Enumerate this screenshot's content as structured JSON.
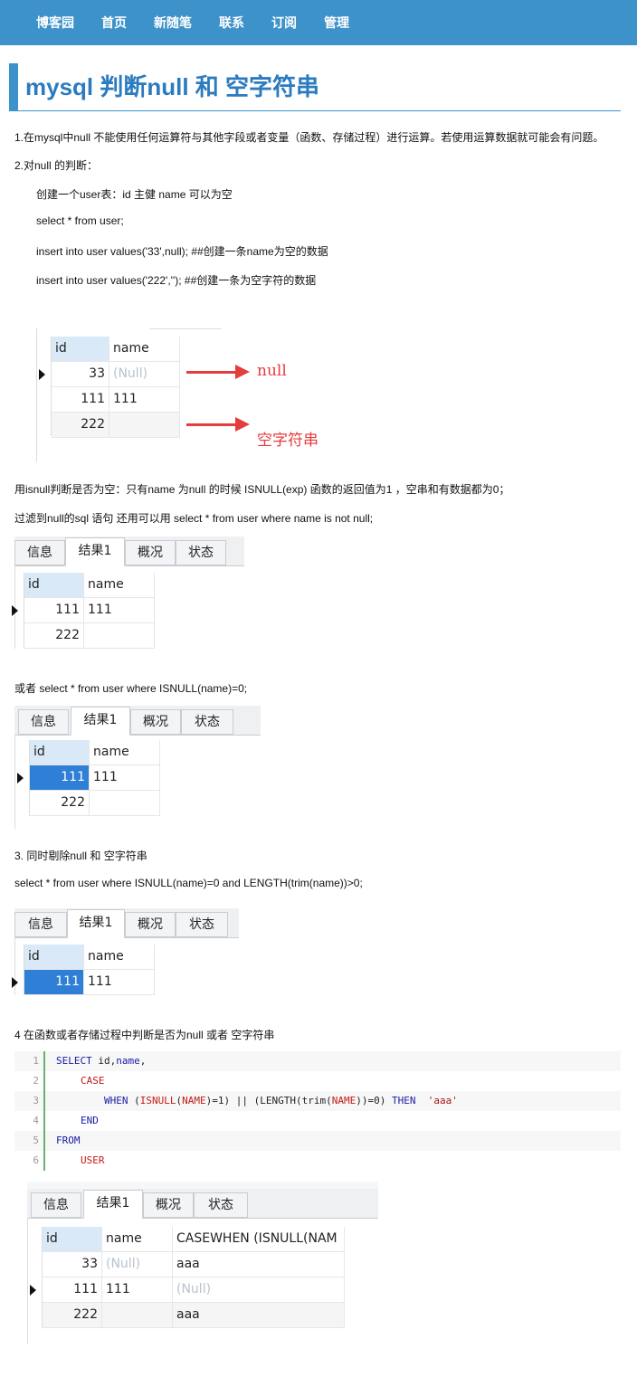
{
  "nav": {
    "items": [
      "博客园",
      "首页",
      "新随笔",
      "联系",
      "订阅",
      "管理"
    ]
  },
  "post": {
    "title": "mysql 判断null 和 空字符串",
    "p1": "1.在mysql中null 不能使用任何运算符与其他字段或者变量（函数、存储过程）进行运算。若使用运算数据就可能会有问题。",
    "p2": "2.对null 的判断：",
    "p3": "创建一个user表：id 主健 name 可以为空",
    "p4": "select * from user;",
    "p5": "insert into user values('33',null);  ##创建一条name为空的数据",
    "p6": "insert into user values('222','');  ##创建一条为空字符的数据",
    "p7": "用isnull判断是否为空：只有name 为null 的时候 ISNULL(exp) 函数的返回值为1 ，空串和有数据都为0；",
    "p8": " 过滤到null的sql 语句 还用可以用  select * from user where name is not null;",
    "p9": "或者  select * from user where ISNULL(name)=0;",
    "p10": "3. 同时剔除null 和 空字符串",
    "p11": "select * from user where ISNULL(name)=0 and LENGTH(trim(name))>0;",
    "p12": "4 在函数或者存储过程中判断是否为null 或者 空字符串"
  },
  "tabs": [
    "信息",
    "结果1",
    "概况",
    "状态"
  ],
  "grid1": {
    "headers": [
      "id",
      "name"
    ],
    "rows": [
      [
        "33",
        "(Null)"
      ],
      [
        "111",
        "111"
      ],
      [
        "222",
        ""
      ]
    ],
    "anno_null": "null",
    "anno_empty": "空字符串"
  },
  "grid2": {
    "headers": [
      "id",
      "name"
    ],
    "rows": [
      [
        "111",
        "111"
      ],
      [
        "222",
        ""
      ]
    ]
  },
  "grid3": {
    "headers": [
      "id",
      "name"
    ],
    "rows": [
      [
        "111",
        "111"
      ],
      [
        "222",
        ""
      ]
    ]
  },
  "grid4": {
    "headers": [
      "id",
      "name"
    ],
    "rows": [
      [
        "111",
        "111"
      ]
    ]
  },
  "grid5": {
    "headers": [
      "id",
      "name",
      "CASEWHEN (ISNULL(NAM"
    ],
    "rows": [
      [
        "33",
        "(Null)",
        "aaa"
      ],
      [
        "111",
        "111",
        "(Null)"
      ],
      [
        "222",
        "",
        "aaa"
      ]
    ]
  },
  "code": {
    "line_numbers": [
      "1",
      "2",
      "3",
      "4",
      "5",
      "6"
    ],
    "l1a": "SELECT",
    "l1b": " id,",
    "l1c": "name",
    "l1d": ",",
    "l2": "CASE",
    "l3a": "WHEN",
    "l3b": " (",
    "l3c": "ISNULL",
    "l3d": "(",
    "l3e": "NAME",
    "l3f": ")=1) || (LENGTH(trim(",
    "l3g": "NAME",
    "l3h": "))=0) ",
    "l3i": "THEN",
    "l3j": "  ",
    "l3k": "'aaa'",
    "l4": "END",
    "l5": "FROM",
    "l6": "USER"
  }
}
